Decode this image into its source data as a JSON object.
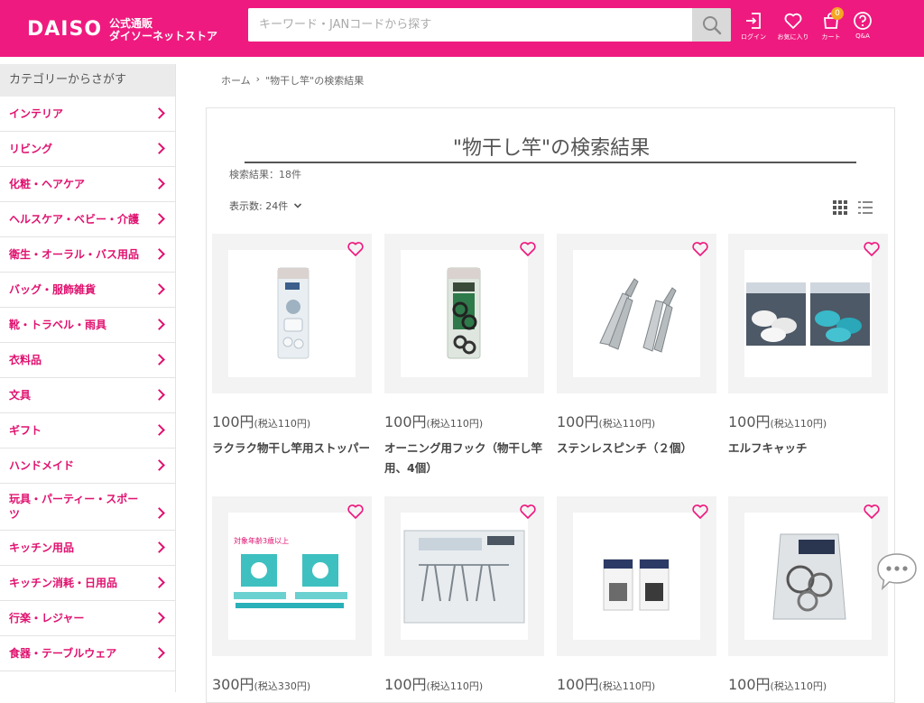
{
  "header": {
    "logo_word": "DAISO",
    "logo_line1": "公式通販",
    "logo_line2": "ダイソーネットストア",
    "search_placeholder": "キーワード・JANコードから探す",
    "nav": {
      "login": "ログイン",
      "favorites": "お気に入り",
      "cart": "カート",
      "cart_count": "0",
      "qa": "Q&A"
    },
    "color": "#ef1a7f"
  },
  "sidebar": {
    "heading": "カテゴリーからさがす",
    "items": [
      "インテリア",
      "リビング",
      "化粧・ヘアケア",
      "ヘルスケア・ベビー・介護",
      "衛生・オーラル・バス用品",
      "バッグ・服飾雑貨",
      "靴・トラベル・雨具",
      "衣料品",
      "文具",
      "ギフト",
      "ハンドメイド",
      "玩具・パーティー・スポーツ",
      "キッチン用品",
      "キッチン消耗・日用品",
      "行楽・レジャー",
      "食器・テーブルウェア"
    ]
  },
  "breadcrumb": {
    "home": "ホーム",
    "sep": "›",
    "current": "\"物干し竿\"の検索結果"
  },
  "results": {
    "title": "\"物干し竿\"の検索結果",
    "count": "検索結果：18件",
    "per_page": "表示数: 24件"
  },
  "products": [
    {
      "price": "100円",
      "tax": "(税込110円)",
      "name": "ラクラク物干し竿用ストッパー",
      "icon": "stopper-package-image"
    },
    {
      "price": "100円",
      "tax": "(税込110円)",
      "name": "オーニング用フック（物干し竿用、4個）",
      "icon": "hook-package-image"
    },
    {
      "price": "100円",
      "tax": "(税込110円)",
      "name": "ステンレスピンチ（２個）",
      "icon": "stainless-pinch-image"
    },
    {
      "price": "100円",
      "tax": "(税込110円)",
      "name": "エルフキャッチ",
      "icon": "elf-catch-image"
    },
    {
      "price": "300円",
      "tax": "(税込330円)",
      "name": "",
      "icon": "toy-package-image",
      "note": "対象年齢3歳以上"
    },
    {
      "price": "100円",
      "tax": "(税込110円)",
      "name": "",
      "icon": "wire-clothespins-image"
    },
    {
      "price": "100円",
      "tax": "(税込110円)",
      "name": "",
      "icon": "clip-packs-image"
    },
    {
      "price": "100円",
      "tax": "(税込110円)",
      "name": "",
      "icon": "hanger-bag-image"
    }
  ]
}
